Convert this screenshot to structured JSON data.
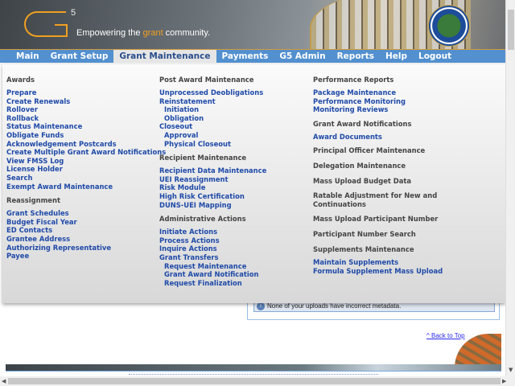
{
  "header": {
    "logo_superscript": "5",
    "tagline_pre": "Empowering the ",
    "tagline_highlight": "grant",
    "tagline_post": " community."
  },
  "nav": {
    "tabs": [
      {
        "label": "Main"
      },
      {
        "label": "Grant Setup"
      },
      {
        "label": "Grant Maintenance",
        "active": true
      },
      {
        "label": "Payments"
      },
      {
        "label": "G5 Admin"
      },
      {
        "label": "Reports"
      },
      {
        "label": "Help"
      },
      {
        "label": "Logout"
      }
    ]
  },
  "menu": {
    "col1": {
      "awards": "Awards",
      "awards_items": [
        "Prepare",
        "Create Renewals",
        "Rollover",
        "Rollback",
        "Status Maintenance",
        "Obligate Funds",
        "Acknowledgement Postcards",
        "Create Multiple Grant Award Notifications",
        "View FMSS Log",
        "License Holder",
        "Search",
        "Exempt Award Maintenance"
      ],
      "reassign": "Reassignment",
      "reassign_items": [
        "Grant Schedules",
        "Budget Fiscal Year",
        "ED Contacts",
        "Grantee Address",
        "Authorizing Representative",
        "Payee"
      ]
    },
    "col2": {
      "post": "Post Award Maintenance",
      "post_items": [
        "Unprocessed Deobligations",
        "Reinstatement",
        "Initiation",
        "Obligation",
        "Closeout",
        "Approval",
        "Physical Closeout"
      ],
      "recipient": "Recipient Maintenance",
      "recipient_items": [
        "Recipient Data Maintenance",
        "UEI Reassignment",
        "Risk Module",
        "High Risk Certification",
        "DUNS-UEI Mapping"
      ],
      "admin": "Administrative Actions",
      "admin_items": [
        "Initiate Actions",
        "Process Actions",
        "Inquire Actions",
        "Grant Transfers",
        "Request Maintenance",
        "Grant Award Notification",
        "Request Finalization"
      ]
    },
    "col3": {
      "perf": "Performance Reports",
      "perf_items": [
        "Package Maintenance",
        "Performance Monitoring",
        "Monitoring Reviews"
      ],
      "gan": "Grant Award Notifications",
      "gan_items": [
        "Award Documents"
      ],
      "principal": "Principal Officer Maintenance",
      "delegation": "Delegation Maintenance",
      "mass_budget": "Mass Upload Budget Data",
      "ratable": "Ratable Adjustment for New and Continuations",
      "mass_participant": "Mass Upload Participant Number",
      "participant_search": "Participant Number Search",
      "supplements": "Supplements Maintenance",
      "supplements_items": [
        "Maintain Supplements",
        "Formula Supplement Mass Upload"
      ]
    }
  },
  "info": {
    "message": "None of your uploads have incorrect metadata."
  },
  "back_to_top": "^ Back to Top",
  "colors": {
    "nav": "#5290cf",
    "link": "#1f4aa8",
    "accent": "#f0a020"
  }
}
